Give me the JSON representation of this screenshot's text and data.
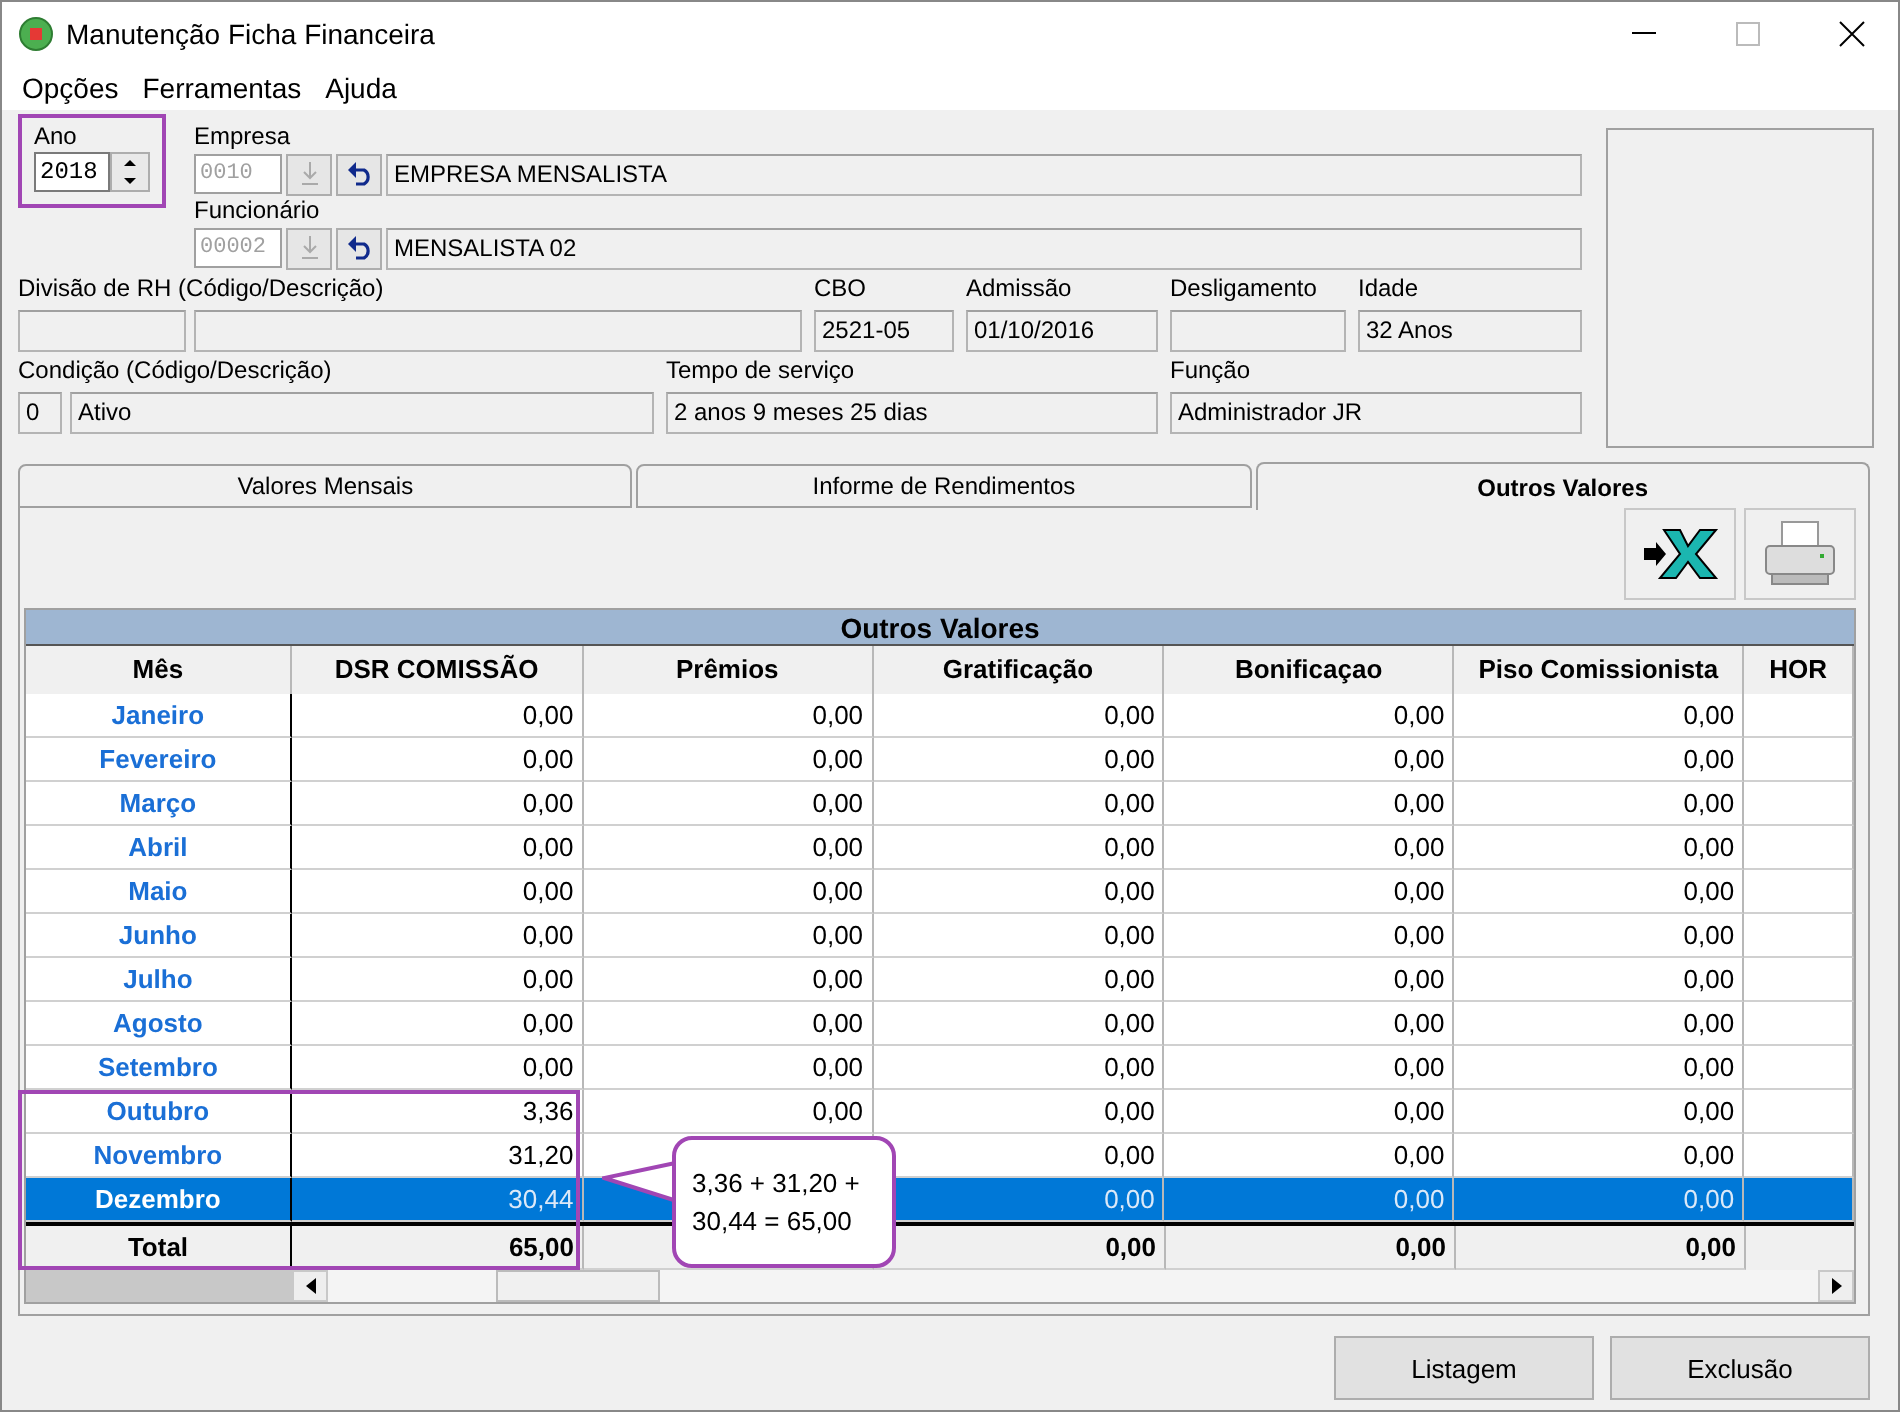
{
  "window": {
    "title": "Manutenção Ficha Financeira"
  },
  "menu": [
    "Opções",
    "Ferramentas",
    "Ajuda"
  ],
  "ano": {
    "label": "Ano",
    "value": "2018"
  },
  "lookups": [
    {
      "label": "Empresa",
      "code": "0010",
      "name": "EMPRESA MENSALISTA"
    },
    {
      "label": "Funcionário",
      "code": "00002",
      "name": "MENSALISTA 02"
    }
  ],
  "info_row_1": [
    {
      "label": "Divisão de RH (Código/Descrição)",
      "kind": "pair"
    },
    {
      "label": "CBO",
      "value": "2521-05",
      "kind": "single"
    },
    {
      "label": "Admissão",
      "value": "01/10/2016",
      "kind": "single"
    },
    {
      "label": "Desligamento",
      "kind": "single"
    },
    {
      "label": "Idade",
      "value": "32 Anos",
      "kind": "single"
    }
  ],
  "info_row_2": [
    {
      "label": "Condição (Código/Descrição)",
      "code": "0",
      "value": "Ativo",
      "kind": "pair"
    },
    {
      "label": "Tempo de serviço",
      "value": "2 anos 9 meses 25 dias",
      "kind": "single"
    },
    {
      "label": "Função",
      "value": "Administrador JR",
      "kind": "single"
    }
  ],
  "tabs": [
    {
      "label": "Valores Mensais",
      "selected": false
    },
    {
      "label": "Informe de Rendimentos",
      "selected": false
    },
    {
      "label": "Outros Valores",
      "selected": true
    }
  ],
  "table": {
    "title": "Outros Valores",
    "columns": [
      "Mês",
      "DSR COMISSÃO",
      "Prêmios",
      "Gratificação",
      "Bonificaçao",
      "Piso Comissionista",
      "HOR"
    ],
    "rows": [
      {
        "month": "Janeiro",
        "cells": {
          "dsr": "0,00",
          "premios": "0,00",
          "gratificacao": "0,00",
          "bonificacao": "0,00",
          "piso": "0,00"
        },
        "selected": false
      },
      {
        "month": "Fevereiro",
        "cells": {
          "dsr": "0,00",
          "premios": "0,00",
          "gratificacao": "0,00",
          "bonificacao": "0,00",
          "piso": "0,00"
        },
        "selected": false
      },
      {
        "month": "Março",
        "cells": {
          "dsr": "0,00",
          "premios": "0,00",
          "gratificacao": "0,00",
          "bonificacao": "0,00",
          "piso": "0,00"
        },
        "selected": false
      },
      {
        "month": "Abril",
        "cells": {
          "dsr": "0,00",
          "premios": "0,00",
          "gratificacao": "0,00",
          "bonificacao": "0,00",
          "piso": "0,00"
        },
        "selected": false
      },
      {
        "month": "Maio",
        "cells": {
          "dsr": "0,00",
          "premios": "0,00",
          "gratificacao": "0,00",
          "bonificacao": "0,00",
          "piso": "0,00"
        },
        "selected": false
      },
      {
        "month": "Junho",
        "cells": {
          "dsr": "0,00",
          "premios": "0,00",
          "gratificacao": "0,00",
          "bonificacao": "0,00",
          "piso": "0,00"
        },
        "selected": false
      },
      {
        "month": "Julho",
        "cells": {
          "dsr": "0,00",
          "premios": "0,00",
          "gratificacao": "0,00",
          "bonificacao": "0,00",
          "piso": "0,00"
        },
        "selected": false
      },
      {
        "month": "Agosto",
        "cells": {
          "dsr": "0,00",
          "premios": "0,00",
          "gratificacao": "0,00",
          "bonificacao": "0,00",
          "piso": "0,00"
        },
        "selected": false
      },
      {
        "month": "Setembro",
        "cells": {
          "dsr": "0,00",
          "premios": "0,00",
          "gratificacao": "0,00",
          "bonificacao": "0,00",
          "piso": "0,00"
        },
        "selected": false
      },
      {
        "month": "Outubro",
        "cells": {
          "dsr": "3,36",
          "premios": "0,00",
          "gratificacao": "0,00",
          "bonificacao": "0,00",
          "piso": "0,00"
        },
        "selected": false
      },
      {
        "month": "Novembro",
        "cells": {
          "dsr": "31,20",
          "gratificacao": "0,00",
          "bonificacao": "0,00",
          "piso": "0,00"
        },
        "selected": false
      },
      {
        "month": "Dezembro",
        "cells": {
          "dsr": "30,44",
          "gratificacao": "0,00",
          "bonificacao": "0,00",
          "piso": "0,00"
        },
        "selected": true
      }
    ],
    "total": {
      "label": "Total",
      "cells": {
        "dsr": "65,00",
        "gratificacao": "0,00",
        "bonificacao": "0,00",
        "piso": "0,00"
      }
    }
  },
  "callout": "3,36 + 31,20 + 30,44 = 65,00",
  "buttons": [
    "Listagem",
    "Exclusão"
  ]
}
